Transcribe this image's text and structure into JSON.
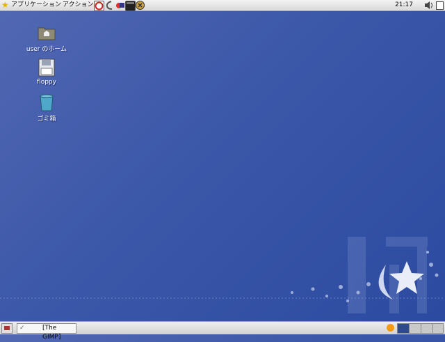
{
  "top_panel": {
    "menus": [
      "アプリケーション",
      "アクション"
    ],
    "launchers": [
      "help-launcher",
      "browser-launcher",
      "mail-launcher",
      "terminal-launcher",
      "clock-launcher"
    ],
    "clock": "21:17",
    "icons": [
      "star-icon",
      "volume-icon",
      "notes-icon"
    ]
  },
  "desktop": {
    "items": [
      {
        "label": "user のホーム",
        "icon": "home-folder-icon"
      },
      {
        "label": "floppy",
        "icon": "floppy-icon"
      },
      {
        "label": "ゴミ箱",
        "icon": "trash-icon"
      }
    ],
    "colors": {
      "background_top": "#5268b3",
      "background_bottom": "#2b4aa0"
    }
  },
  "bottom_panel": {
    "tasks": [
      {
        "label": "[The GIMP]"
      }
    ],
    "workspaces": 4,
    "active_workspace": 1
  }
}
